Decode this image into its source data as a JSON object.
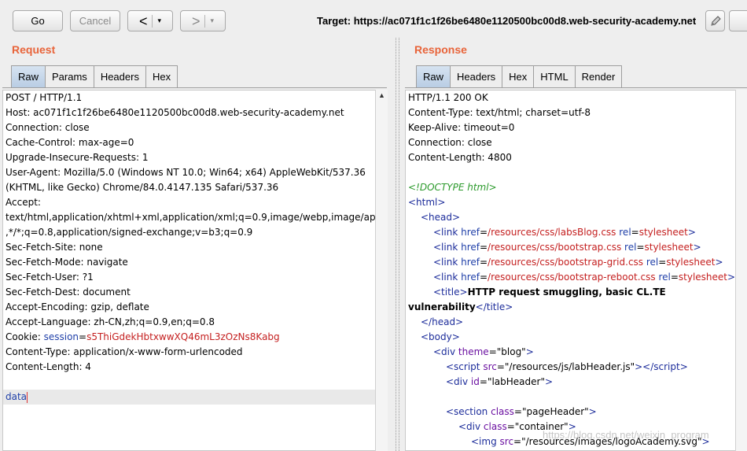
{
  "toolbar": {
    "go_label": "Go",
    "cancel_label": "Cancel",
    "back_arrow": "<",
    "forward_arrow": ">",
    "dropdown_glyph": "▾",
    "target_label": "Target: https://ac071f1c1f26be6480e1120500bc00d8.web-security-academy.net"
  },
  "request": {
    "title": "Request",
    "tabs": [
      "Raw",
      "Params",
      "Headers",
      "Hex"
    ],
    "lines": [
      "POST / HTTP/1.1",
      "Host: ac071f1c1f26be6480e1120500bc00d8.web-security-academy.net",
      "Connection: close",
      "Cache-Control: max-age=0",
      "Upgrade-Insecure-Requests: 1",
      "User-Agent: Mozilla/5.0 (Windows NT 10.0; Win64; x64) AppleWebKit/537.36",
      "(KHTML, like Gecko) Chrome/84.0.4147.135 Safari/537.36",
      "Accept:",
      "text/html,application/xhtml+xml,application/xml;q=0.9,image/webp,image/apng",
      ",*/*;q=0.8,application/signed-exchange;v=b3;q=0.9",
      "Sec-Fetch-Site: none",
      "Sec-Fetch-Mode: navigate",
      "Sec-Fetch-User: ?1",
      "Sec-Fetch-Dest: document",
      "Accept-Encoding: gzip, deflate",
      "Accept-Language: zh-CN,zh;q=0.9,en;q=0.8"
    ],
    "cookie_prefix": "Cookie: ",
    "cookie_name": "session",
    "cookie_eq": "=",
    "cookie_value": "s5ThiGdekHbtxwwXQ46mL3zOzNs8Kabg",
    "lines_after": [
      "Content-Type: application/x-www-form-urlencoded",
      "Content-Length: 4"
    ],
    "body": "data"
  },
  "response": {
    "title": "Response",
    "tabs": [
      "Raw",
      "Headers",
      "Hex",
      "HTML",
      "Render"
    ],
    "headers": [
      "HTTP/1.1 200 OK",
      "Content-Type: text/html; charset=utf-8",
      "Keep-Alive: timeout=0",
      "Connection: close",
      "Content-Length: 4800"
    ],
    "doctype": "<!DOCTYPE html>",
    "links": [
      "/resources/css/labsBlog.css",
      "/resources/css/bootstrap.css",
      "/resources/css/bootstrap-grid.css",
      "/resources/css/bootstrap-reboot.css"
    ],
    "title_text_1": "HTTP request smuggling, basic CL.TE",
    "title_text_2": "vulnerability",
    "div_theme": "\"blog\"",
    "script_src": "\"/resources/js/labHeader.js\"",
    "div_id": "\"labHeader\"",
    "section_class": "\"pageHeader\"",
    "container_class": "\"container\"",
    "img_src": "\"/resources/images/logoAcademy.svg\""
  },
  "watermark": "https://blog.csdn.net/weixin_program"
}
